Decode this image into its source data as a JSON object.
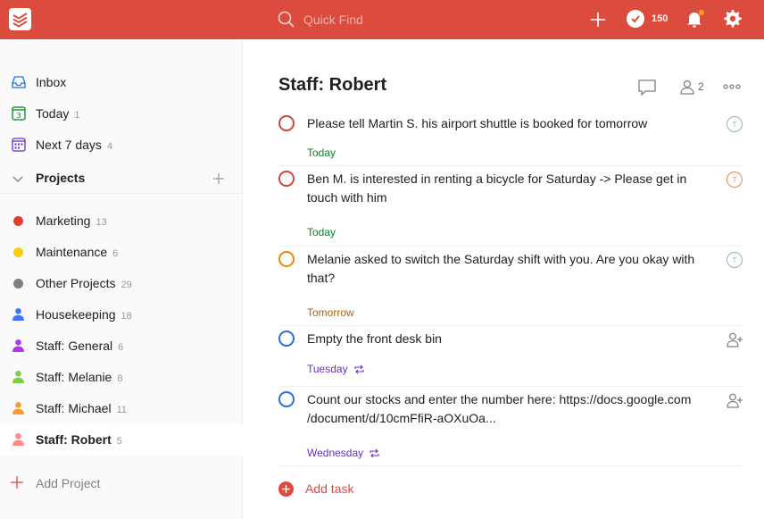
{
  "topbar": {
    "search_placeholder": "Quick Find",
    "karma_count": "150",
    "notification_badge_color": "#ff9a14",
    "brand_color": "#db4c3f"
  },
  "sidebar": {
    "nav": [
      {
        "label": "Inbox",
        "count": "",
        "icon": "inbox-icon"
      },
      {
        "label": "Today",
        "count": "1",
        "icon": "calendar-today-icon",
        "icon_text": "3"
      },
      {
        "label": "Next 7 days",
        "count": "4",
        "icon": "calendar-week-icon"
      }
    ],
    "projects_title": "Projects",
    "projects": [
      {
        "label": "Marketing",
        "count": "13",
        "color": "#db4035",
        "kind": "dot"
      },
      {
        "label": "Maintenance",
        "count": "6",
        "color": "#fad000",
        "kind": "dot"
      },
      {
        "label": "Other Projects",
        "count": "29",
        "color": "#808080",
        "kind": "dot"
      },
      {
        "label": "Housekeeping",
        "count": "18",
        "color": "#4073ff",
        "kind": "person"
      },
      {
        "label": "Staff: General",
        "count": "6",
        "color": "#af38eb",
        "kind": "person"
      },
      {
        "label": "Staff: Melanie",
        "count": "8",
        "color": "#7ecc49",
        "kind": "person"
      },
      {
        "label": "Staff: Michael",
        "count": "11",
        "color": "#ff9933",
        "kind": "person"
      },
      {
        "label": "Staff: Robert",
        "count": "5",
        "color": "#ff8d85",
        "kind": "person",
        "active": true
      }
    ],
    "add_project_label": "Add Project"
  },
  "main": {
    "title": "Staff: Robert",
    "share_count": "2",
    "tasks": [
      {
        "text": "Please tell Martin S. his airport shuttle is booked for tomorrow",
        "due": "Today",
        "due_color": "#058527",
        "priority_color": "#d1453b",
        "assignee": "T",
        "assignee_color": "#8fb8a8",
        "recurring": false
      },
      {
        "text": "Ben M. is interested in renting a bicycle for Saturday -> Please get in touch with him",
        "due": "Today",
        "due_color": "#058527",
        "priority_color": "#d1453b",
        "assignee": "T",
        "assignee_color": "#e08a4f",
        "recurring": false
      },
      {
        "text": "Melanie asked to switch the Saturday shift with you. Are you okay with that?",
        "due": "Tomorrow",
        "due_color": "#ad6200",
        "priority_color": "#eb8909",
        "assignee": "T",
        "assignee_color": "#8fb8a8",
        "recurring": false
      },
      {
        "text": "Empty the front desk bin",
        "due": "Tuesday",
        "due_color": "#692fc2",
        "priority_color": "#246fe0",
        "assignee": "",
        "recurring": true
      },
      {
        "text": "Count our stocks and enter the number here: https://docs.google.com /document/d/10cmFfiR-aOXuOa...",
        "due": "Wednesday",
        "due_color": "#692fc2",
        "priority_color": "#246fe0",
        "assignee": "",
        "recurring": true
      }
    ],
    "add_task_label": "Add task"
  }
}
